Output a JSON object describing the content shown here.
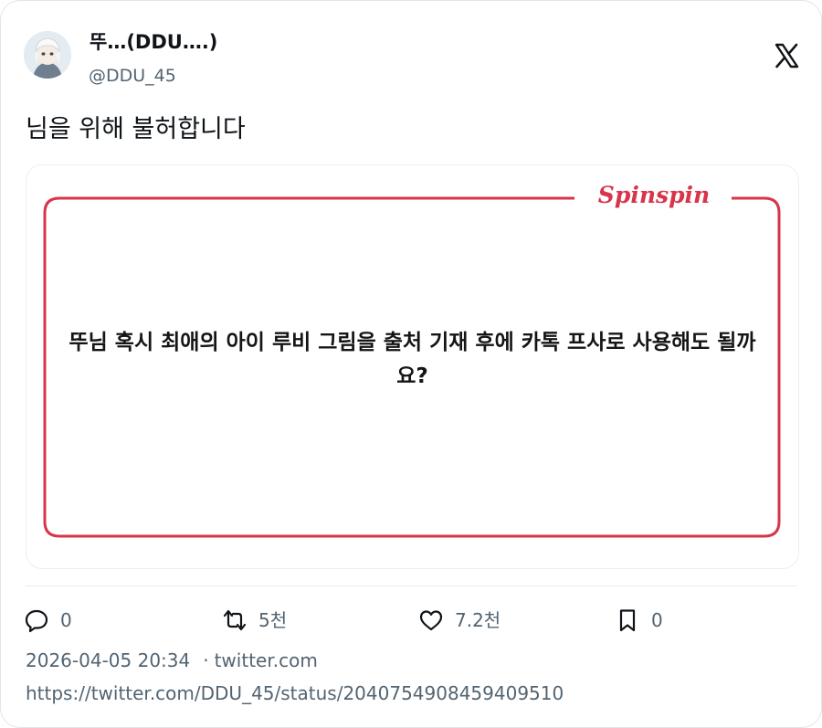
{
  "author": {
    "display_name": "뚜…(DDU….)",
    "handle": "@DDU_45"
  },
  "icons": {
    "avatar": "avatar",
    "platform_logo": "x-logo-icon",
    "reply": "reply-icon",
    "retweet": "retweet-icon",
    "like": "heart-icon",
    "bookmark": "bookmark-icon"
  },
  "tweet": {
    "text": "님을 위해 불허합니다"
  },
  "media": {
    "brand": "Spinspin",
    "question": "뚜님 혹시 최애의 아이 루비 그림을 출처 기재 후에 카톡 프사로 사용해도 될까요?",
    "frame_color": "#d8344a"
  },
  "actions": {
    "replies": "0",
    "retweets": "5천",
    "likes": "7.2천",
    "bookmarks": "0"
  },
  "meta": {
    "timestamp": "2026-04-05 20:34",
    "separator": "·",
    "source": "twitter.com",
    "url": "https://twitter.com/DDU_45/status/2040754908459409510"
  },
  "colors": {
    "text_primary": "#0f1419",
    "text_secondary": "#536471",
    "accent": "#d8344a"
  }
}
